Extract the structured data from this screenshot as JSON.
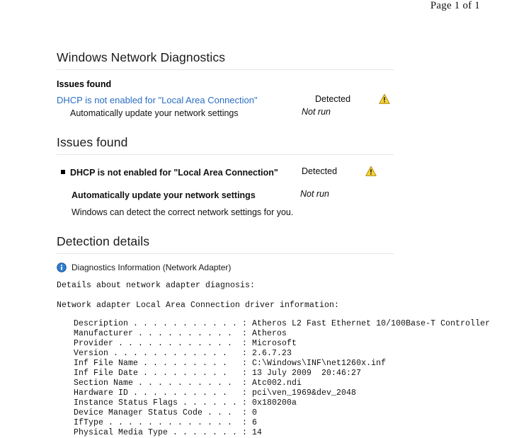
{
  "page": {
    "pagination": "Page 1 of 1"
  },
  "report": {
    "title": "Windows Network Diagnostics",
    "summary": {
      "heading": "Issues found",
      "issue_link": "DHCP is not enabled for \"Local Area Connection\"",
      "issue_status": "Detected",
      "issue_icon": "warning-icon",
      "action_text": "Automatically update your network settings",
      "action_status": "Not run"
    },
    "details_section": {
      "heading": "Issues found",
      "issue_title": "DHCP is not enabled for \"Local Area Connection\"",
      "issue_status": "Detected",
      "issue_icon": "warning-icon",
      "action_title": "Automatically update your network settings",
      "action_status": "Not run",
      "action_description": "Windows can detect the correct network settings for you."
    },
    "detection_details": {
      "heading": "Detection details",
      "info_icon": "info-icon",
      "info_label": "Diagnostics Information (Network Adapter)",
      "intro_line": "Details about network adapter diagnosis:",
      "adapter_line": "Network adapter Local Area Connection driver information:",
      "fields": [
        {
          "label": "Description",
          "dots": ". . . . . . . . . . .",
          "value": "Atheros L2 Fast Ethernet 10/100Base-T Controller"
        },
        {
          "label": "Manufacturer",
          "dots": ". . . . . . . . . .",
          "value": "Atheros"
        },
        {
          "label": "Provider",
          "dots": ". . . . . . . . . . . .",
          "value": "Microsoft"
        },
        {
          "label": "Version",
          "dots": ". . . . . . . . . . . .",
          "value": "2.6.7.23"
        },
        {
          "label": "Inf File Name",
          "dots": ". . . . . . . . .",
          "value": "C:\\Windows\\INF\\net1260x.inf"
        },
        {
          "label": "Inf File Date",
          "dots": ". . . . . . . . .",
          "value": "13 July 2009  20:46:27"
        },
        {
          "label": "Section Name",
          "dots": ". . . . . . . . . .",
          "value": "Atc002.ndi"
        },
        {
          "label": "Hardware ID",
          "dots": ". . . . . . . . . .",
          "value": "pci\\ven_1969&dev_2048"
        },
        {
          "label": "Instance Status Flags",
          "dots": ". . . . . .",
          "value": "0x180200a"
        },
        {
          "label": "Device Manager Status Code",
          "dots": ". . .",
          "value": "0"
        },
        {
          "label": "IfType",
          "dots": ". . . . . . . . . . . . .",
          "value": "6"
        },
        {
          "label": "Physical Media Type",
          "dots": ". . . . . . .",
          "value": "14"
        }
      ]
    }
  },
  "colors": {
    "link": "#2a6ec4",
    "warning": "#f3c41a",
    "info": "#1a6fc4",
    "rule": "#e6e6e6"
  }
}
